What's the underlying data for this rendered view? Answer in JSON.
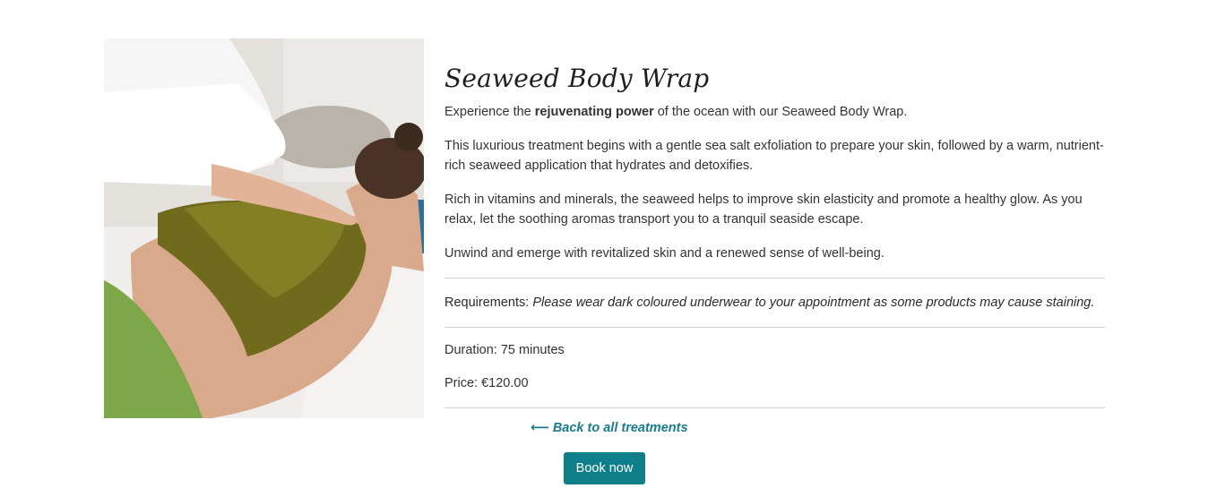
{
  "treatment": {
    "title": "Seaweed Body Wrap",
    "intro_before": "Experience the ",
    "intro_bold": "rejuvenating power",
    "intro_after": " of the ocean with our Seaweed Body Wrap.",
    "paragraph_1": "This luxurious treatment begins with a gentle sea salt exfoliation to prepare your skin, followed by a warm, nutrient-rich seaweed application that hydrates and detoxifies.",
    "paragraph_2": "Rich in vitamins and minerals, the seaweed helps to improve skin elasticity and promote a healthy glow. As you relax, let the soothing aromas transport you to a tranquil seaside escape.",
    "paragraph_3": "Unwind and emerge with revitalized skin and a renewed sense of well-being.",
    "requirements_label": "Requirements: ",
    "requirements_text": "Please wear dark coloured underwear to your appointment as some products may cause staining.",
    "duration": "Duration: 75 minutes",
    "price": "Price: €120.00"
  },
  "actions": {
    "back_link": "⟵ Back to all treatments",
    "book_button": "Book now"
  },
  "colors": {
    "accent": "#0f7f8c",
    "link": "#1a7b8a",
    "divider": "#cfcfcf"
  }
}
